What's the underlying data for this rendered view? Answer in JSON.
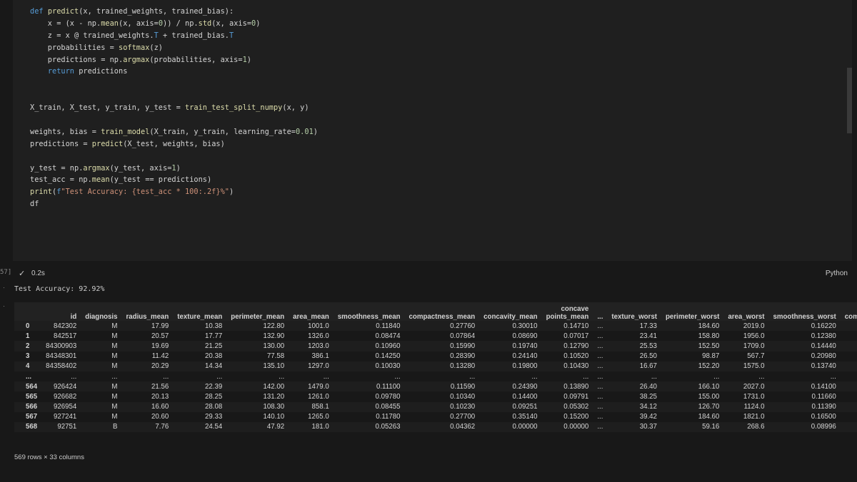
{
  "code_lines": [
    "def predict(x, trained_weights, trained_bias):",
    "    x = (x - np.mean(x, axis=0)) / np.std(x, axis=0)",
    "    z = x @ trained_weights.T + trained_bias.T",
    "    probabilities = softmax(z)",
    "    predictions = np.argmax(probabilities, axis=1)",
    "    return predictions",
    "",
    "",
    "X_train, X_test, y_train, y_test = train_test_split_numpy(x, y)",
    "",
    "weights, bias = train_model(X_train, y_train, learning_rate=0.01)",
    "predictions = predict(X_test, weights, bias)",
    "",
    "y_test = np.argmax(y_test, axis=1)",
    "test_acc = np.mean(y_test == predictions)",
    "print(f\"Test Accuracy: {test_acc * 100:.2f}%\")",
    "df"
  ],
  "cell": {
    "exec_count": "57]",
    "time": "0.2s",
    "language": "Python",
    "check_icon": "check-icon"
  },
  "output": {
    "text": "Test Accuracy: 92.92%",
    "caption": "569 rows × 33 columns"
  },
  "table": {
    "columns": [
      "",
      "id",
      "diagnosis",
      "radius_mean",
      "texture_mean",
      "perimeter_mean",
      "area_mean",
      "smoothness_mean",
      "compactness_mean",
      "concavity_mean",
      "concave points_mean",
      "...",
      "texture_worst",
      "perimeter_worst",
      "area_worst",
      "smoothness_worst",
      "compactne"
    ],
    "rows": [
      [
        "0",
        "842302",
        "M",
        "17.99",
        "10.38",
        "122.80",
        "1001.0",
        "0.11840",
        "0.27760",
        "0.30010",
        "0.14710",
        "...",
        "17.33",
        "184.60",
        "2019.0",
        "0.16220",
        ""
      ],
      [
        "1",
        "842517",
        "M",
        "20.57",
        "17.77",
        "132.90",
        "1326.0",
        "0.08474",
        "0.07864",
        "0.08690",
        "0.07017",
        "...",
        "23.41",
        "158.80",
        "1956.0",
        "0.12380",
        ""
      ],
      [
        "2",
        "84300903",
        "M",
        "19.69",
        "21.25",
        "130.00",
        "1203.0",
        "0.10960",
        "0.15990",
        "0.19740",
        "0.12790",
        "...",
        "25.53",
        "152.50",
        "1709.0",
        "0.14440",
        ""
      ],
      [
        "3",
        "84348301",
        "M",
        "11.42",
        "20.38",
        "77.58",
        "386.1",
        "0.14250",
        "0.28390",
        "0.24140",
        "0.10520",
        "...",
        "26.50",
        "98.87",
        "567.7",
        "0.20980",
        ""
      ],
      [
        "4",
        "84358402",
        "M",
        "20.29",
        "14.34",
        "135.10",
        "1297.0",
        "0.10030",
        "0.13280",
        "0.19800",
        "0.10430",
        "...",
        "16.67",
        "152.20",
        "1575.0",
        "0.13740",
        ""
      ],
      [
        "...",
        "...",
        "...",
        "...",
        "...",
        "...",
        "...",
        "...",
        "...",
        "...",
        "...",
        "...",
        "...",
        "...",
        "...",
        "...",
        ""
      ],
      [
        "564",
        "926424",
        "M",
        "21.56",
        "22.39",
        "142.00",
        "1479.0",
        "0.11100",
        "0.11590",
        "0.24390",
        "0.13890",
        "...",
        "26.40",
        "166.10",
        "2027.0",
        "0.14100",
        ""
      ],
      [
        "565",
        "926682",
        "M",
        "20.13",
        "28.25",
        "131.20",
        "1261.0",
        "0.09780",
        "0.10340",
        "0.14400",
        "0.09791",
        "...",
        "38.25",
        "155.00",
        "1731.0",
        "0.11660",
        ""
      ],
      [
        "566",
        "926954",
        "M",
        "16.60",
        "28.08",
        "108.30",
        "858.1",
        "0.08455",
        "0.10230",
        "0.09251",
        "0.05302",
        "...",
        "34.12",
        "126.70",
        "1124.0",
        "0.11390",
        ""
      ],
      [
        "567",
        "927241",
        "M",
        "20.60",
        "29.33",
        "140.10",
        "1265.0",
        "0.11780",
        "0.27700",
        "0.35140",
        "0.15200",
        "...",
        "39.42",
        "184.60",
        "1821.0",
        "0.16500",
        ""
      ],
      [
        "568",
        "92751",
        "B",
        "7.76",
        "24.54",
        "47.92",
        "181.0",
        "0.05263",
        "0.04362",
        "0.00000",
        "0.00000",
        "...",
        "30.37",
        "59.16",
        "268.6",
        "0.08996",
        ""
      ]
    ]
  }
}
